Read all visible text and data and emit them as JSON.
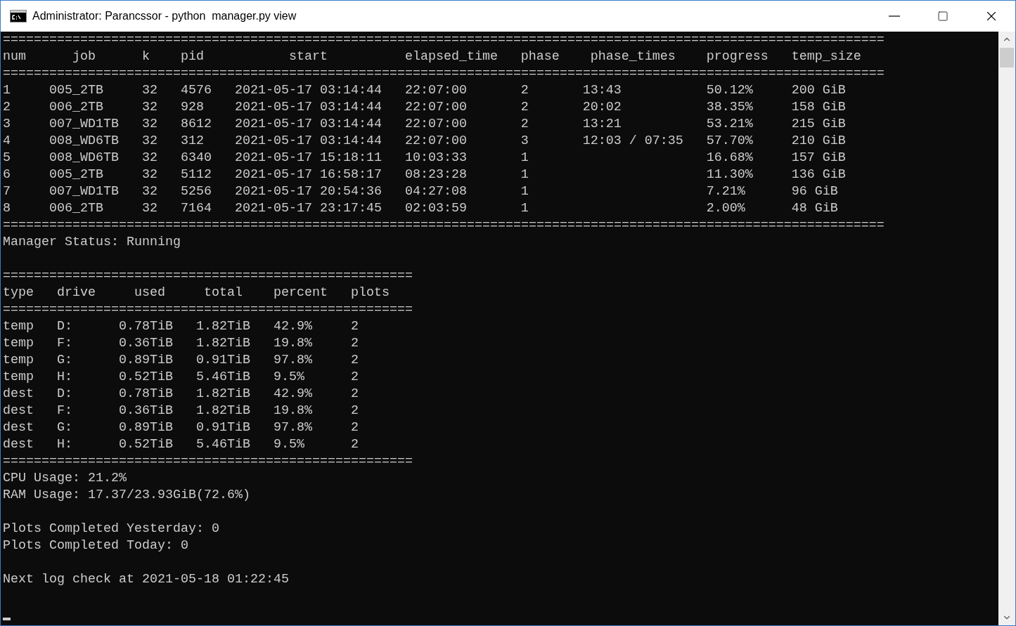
{
  "window": {
    "title": "Administrator: Parancssor - python  manager.py view"
  },
  "console": {
    "jobs_table": {
      "rule": "==================================================================================================================",
      "columns": [
        "num",
        "job",
        "k",
        "pid",
        "start",
        "elapsed_time",
        "phase",
        "phase_times",
        "progress",
        "temp_size"
      ],
      "rows": [
        [
          "1",
          "005_2TB",
          "32",
          "4576",
          "2021-05-17 03:14:44",
          "22:07:00",
          "2",
          "13:43",
          "50.12%",
          "200 GiB"
        ],
        [
          "2",
          "006_2TB",
          "32",
          "928",
          "2021-05-17 03:14:44",
          "22:07:00",
          "2",
          "20:02",
          "38.35%",
          "158 GiB"
        ],
        [
          "3",
          "007_WD1TB",
          "32",
          "8612",
          "2021-05-17 03:14:44",
          "22:07:00",
          "2",
          "13:21",
          "53.21%",
          "215 GiB"
        ],
        [
          "4",
          "008_WD6TB",
          "32",
          "312",
          "2021-05-17 03:14:44",
          "22:07:00",
          "3",
          "12:03 / 07:35",
          "57.70%",
          "210 GiB"
        ],
        [
          "5",
          "008_WD6TB",
          "32",
          "6340",
          "2021-05-17 15:18:11",
          "10:03:33",
          "1",
          null,
          "16.68%",
          "157 GiB"
        ],
        [
          "6",
          "005_2TB",
          "32",
          "5112",
          "2021-05-17 16:58:17",
          "08:23:28",
          "1",
          null,
          "11.30%",
          "136 GiB"
        ],
        [
          "7",
          "007_WD1TB",
          "32",
          "5256",
          "2021-05-17 20:54:36",
          "04:27:08",
          "1",
          null,
          "7.21%",
          "96 GiB"
        ],
        [
          "8",
          "006_2TB",
          "32",
          "7164",
          "2021-05-17 23:17:45",
          "02:03:59",
          "1",
          null,
          "2.00%",
          "48 GiB"
        ]
      ]
    },
    "manager_status": "Manager Status: Running",
    "drives_table": {
      "rule": "=====================================================",
      "columns": [
        "type",
        "drive",
        "used",
        "total",
        "percent",
        "plots"
      ],
      "rows": [
        [
          "temp",
          "D:",
          "0.78TiB",
          "1.82TiB",
          "42.9%",
          "2"
        ],
        [
          "temp",
          "F:",
          "0.36TiB",
          "1.82TiB",
          "19.8%",
          "2"
        ],
        [
          "temp",
          "G:",
          "0.89TiB",
          "0.91TiB",
          "97.8%",
          "2"
        ],
        [
          "temp",
          "H:",
          "0.52TiB",
          "5.46TiB",
          "9.5%",
          "2"
        ],
        [
          "dest",
          "D:",
          "0.78TiB",
          "1.82TiB",
          "42.9%",
          "2"
        ],
        [
          "dest",
          "F:",
          "0.36TiB",
          "1.82TiB",
          "19.8%",
          "2"
        ],
        [
          "dest",
          "G:",
          "0.89TiB",
          "0.91TiB",
          "97.8%",
          "2"
        ],
        [
          "dest",
          "H:",
          "0.52TiB",
          "5.46TiB",
          "9.5%",
          "2"
        ]
      ]
    },
    "cpu_usage": "CPU Usage: 21.2%",
    "ram_usage": "RAM Usage: 17.37/23.93GiB(72.6%)",
    "plots_yesterday": "Plots Completed Yesterday: 0",
    "plots_today": "Plots Completed Today: 0",
    "next_log_check": "Next log check at 2021-05-18 01:22:45"
  }
}
